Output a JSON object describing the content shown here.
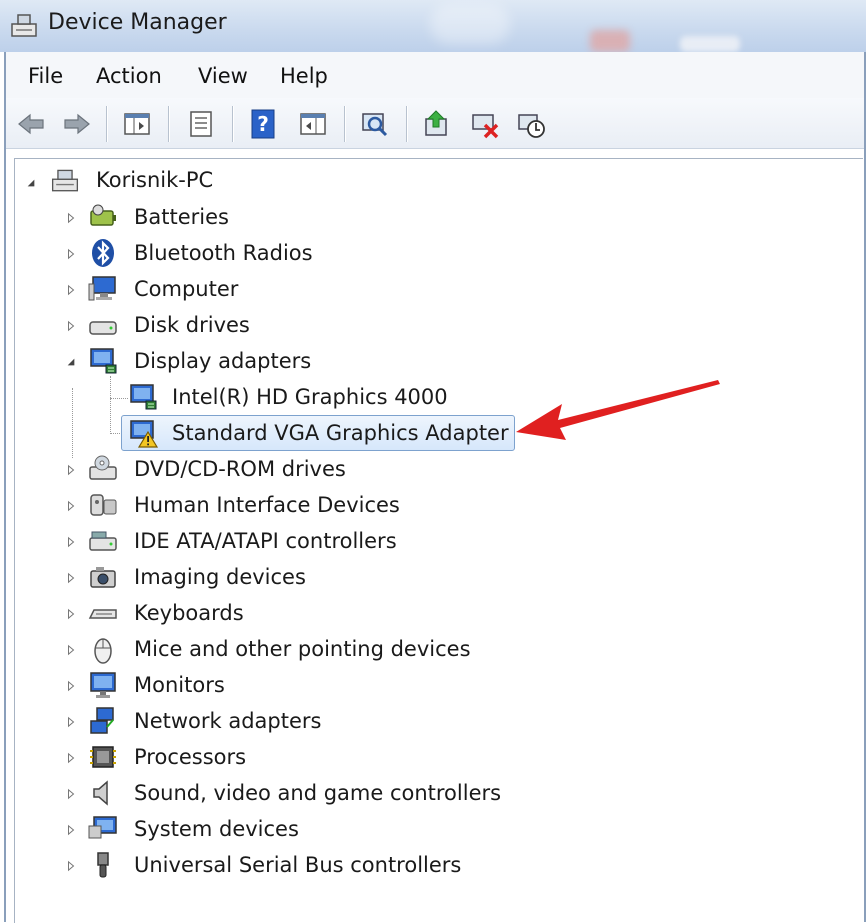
{
  "window": {
    "title": "Device Manager"
  },
  "menu": [
    "File",
    "Action",
    "View",
    "Help"
  ],
  "toolbar": {
    "buttons": [
      "back-icon",
      "forward-icon",
      "show-hide-console-tree-icon",
      "properties-icon",
      "help-icon",
      "action-pane-icon",
      "scan-hardware-icon",
      "update-driver-icon",
      "uninstall-icon",
      "disable-icon"
    ]
  },
  "tree": {
    "root": "Korisnik-PC",
    "categories": [
      {
        "label": "Batteries",
        "icon": "battery-icon",
        "expanded": false
      },
      {
        "label": "Bluetooth Radios",
        "icon": "bluetooth-icon",
        "expanded": false
      },
      {
        "label": "Computer",
        "icon": "computer-icon",
        "expanded": false
      },
      {
        "label": "Disk drives",
        "icon": "disk-drive-icon",
        "expanded": false
      },
      {
        "label": "Display adapters",
        "icon": "display-adapter-icon",
        "expanded": true,
        "children": [
          {
            "label": "Intel(R) HD Graphics 4000",
            "icon": "display-adapter-icon",
            "warning": false
          },
          {
            "label": "Standard VGA Graphics Adapter",
            "icon": "display-adapter-warning-icon",
            "warning": true,
            "selected": true
          }
        ]
      },
      {
        "label": "DVD/CD-ROM drives",
        "icon": "dvd-drive-icon",
        "expanded": false
      },
      {
        "label": "Human Interface Devices",
        "icon": "hid-icon",
        "expanded": false
      },
      {
        "label": "IDE ATA/ATAPI controllers",
        "icon": "ide-controller-icon",
        "expanded": false
      },
      {
        "label": "Imaging devices",
        "icon": "camera-icon",
        "expanded": false
      },
      {
        "label": "Keyboards",
        "icon": "keyboard-icon",
        "expanded": false
      },
      {
        "label": "Mice and other pointing devices",
        "icon": "mouse-icon",
        "expanded": false
      },
      {
        "label": "Monitors",
        "icon": "monitor-icon",
        "expanded": false
      },
      {
        "label": "Network adapters",
        "icon": "network-adapter-icon",
        "expanded": false
      },
      {
        "label": "Processors",
        "icon": "processor-icon",
        "expanded": false
      },
      {
        "label": "Sound, video and game controllers",
        "icon": "speaker-icon",
        "expanded": false
      },
      {
        "label": "System devices",
        "icon": "system-device-icon",
        "expanded": false
      },
      {
        "label": "Universal Serial Bus controllers",
        "icon": "usb-icon",
        "expanded": false
      }
    ]
  },
  "annotation": {
    "arrow_color": "#e02020"
  }
}
